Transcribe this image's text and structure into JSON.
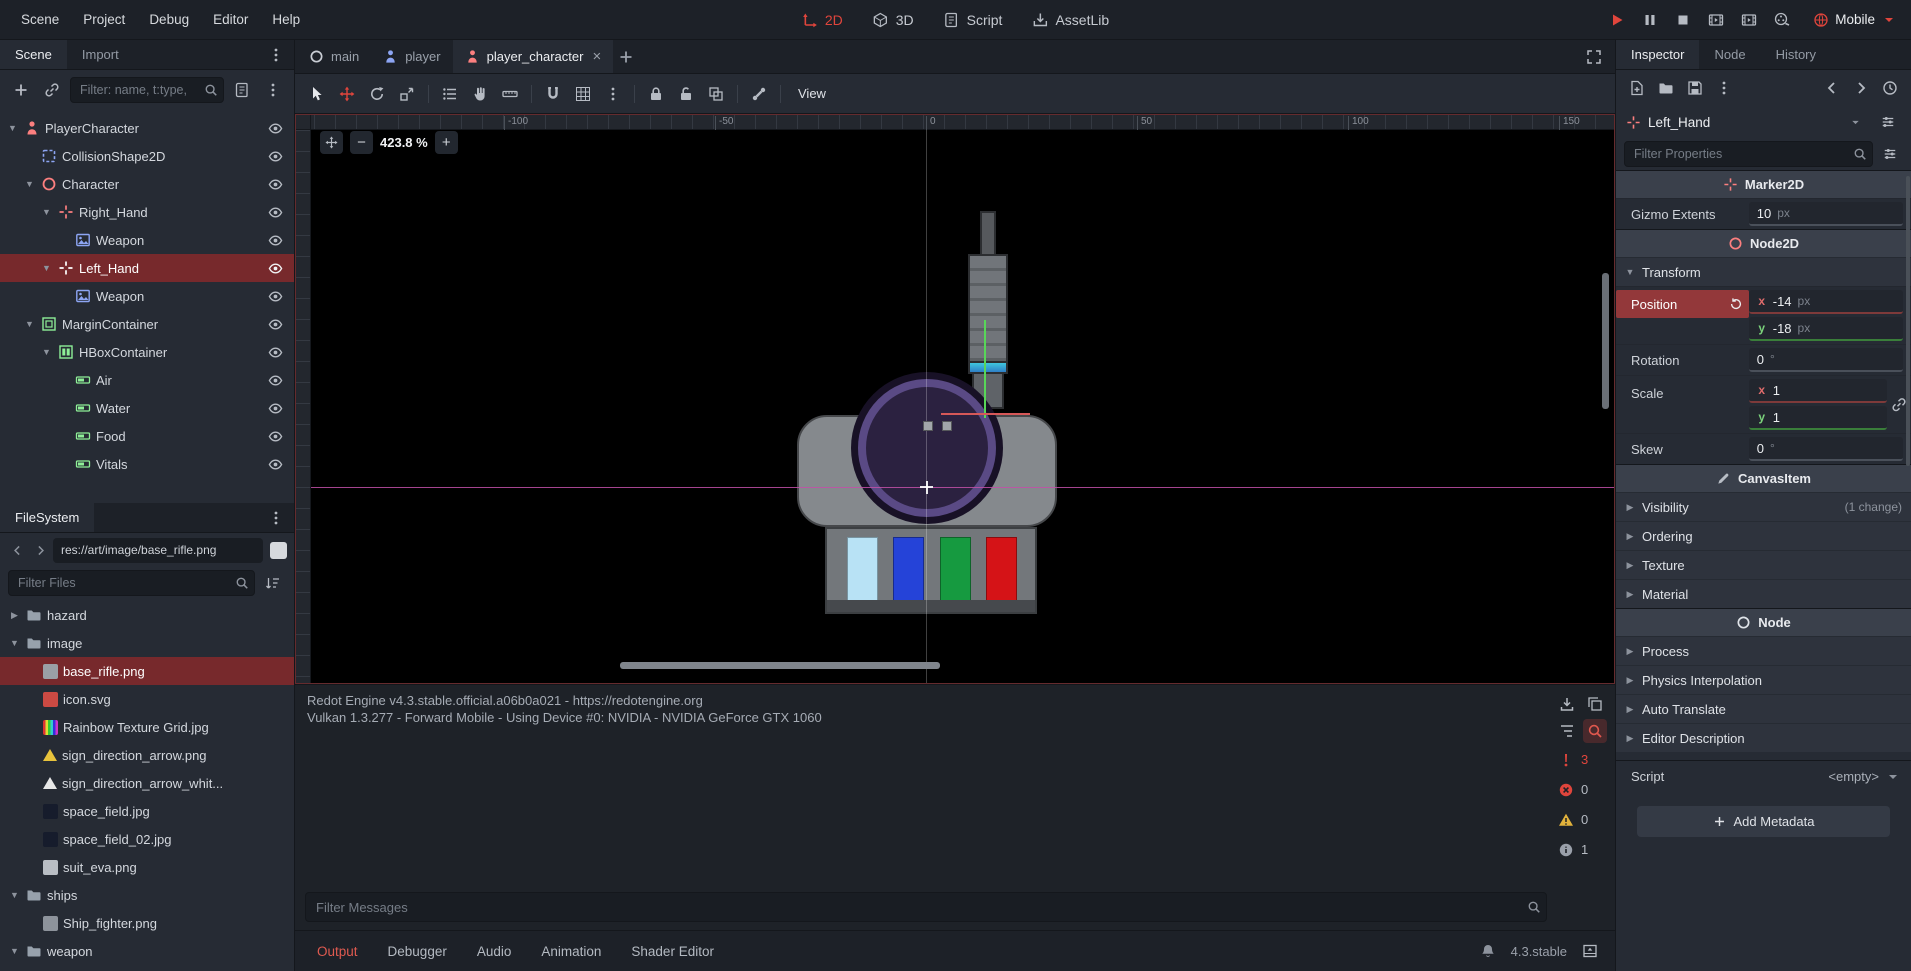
{
  "app": {
    "accent": "#e0453c"
  },
  "menubar": {
    "menus": [
      "Scene",
      "Project",
      "Debug",
      "Editor",
      "Help"
    ],
    "workspaces": [
      {
        "label": "2D",
        "icon": "axes",
        "active": true
      },
      {
        "label": "3D",
        "icon": "cube",
        "active": false
      },
      {
        "label": "Script",
        "icon": "script",
        "active": false
      },
      {
        "label": "AssetLib",
        "icon": "assetlib",
        "active": false
      }
    ],
    "playback": [
      {
        "name": "play",
        "icon": "play",
        "accent": true
      },
      {
        "name": "pause",
        "icon": "pause",
        "accent": false
      },
      {
        "name": "stop",
        "icon": "stop",
        "accent": false
      },
      {
        "name": "play-scene",
        "icon": "film",
        "accent": false
      },
      {
        "name": "play-custom-scene",
        "icon": "film",
        "accent": false
      },
      {
        "name": "movie-maker",
        "icon": "reel",
        "accent": false
      }
    ],
    "renderer_label": "Mobile"
  },
  "left_dock": {
    "tabs": [
      {
        "label": "Scene",
        "active": true
      },
      {
        "label": "Import",
        "active": false
      }
    ],
    "filter_placeholder": "Filter: name, t:type,",
    "scene_tree": [
      {
        "label": "PlayerCharacter",
        "level": 0,
        "arrow": "v",
        "icon": "body",
        "color": "#fc7f7f",
        "selected": false
      },
      {
        "label": "CollisionShape2D",
        "level": 1,
        "arrow": "",
        "icon": "collision",
        "color": "#8da5f3",
        "selected": false
      },
      {
        "label": "Character",
        "level": 1,
        "arrow": "v",
        "icon": "nodec",
        "color": "#fc7f7f",
        "selected": false
      },
      {
        "label": "Right_Hand",
        "level": 2,
        "arrow": "v",
        "icon": "marker",
        "color": "#fc7f7f",
        "selected": false
      },
      {
        "label": "Weapon",
        "level": 3,
        "arrow": "",
        "icon": "sprite",
        "color": "#8da5f3",
        "selected": false
      },
      {
        "label": "Left_Hand",
        "level": 2,
        "arrow": "v",
        "icon": "marker",
        "color": "#ffffff",
        "selected": true
      },
      {
        "label": "Weapon",
        "level": 3,
        "arrow": "",
        "icon": "sprite",
        "color": "#8da5f3",
        "selected": false
      },
      {
        "label": "MarginContainer",
        "level": 1,
        "arrow": "v",
        "icon": "container",
        "color": "#8eef97",
        "selected": false
      },
      {
        "label": "HBoxContainer",
        "level": 2,
        "arrow": "v",
        "icon": "hbox",
        "color": "#8eef97",
        "selected": false
      },
      {
        "label": "Air",
        "level": 3,
        "arrow": "",
        "icon": "progress",
        "color": "#8eef97",
        "selected": false
      },
      {
        "label": "Water",
        "level": 3,
        "arrow": "",
        "icon": "progress",
        "color": "#8eef97",
        "selected": false
      },
      {
        "label": "Food",
        "level": 3,
        "arrow": "",
        "icon": "progress",
        "color": "#8eef97",
        "selected": false
      },
      {
        "label": "Vitals",
        "level": 3,
        "arrow": "",
        "icon": "progress",
        "color": "#8eef97",
        "selected": false
      }
    ],
    "filesystem": {
      "title": "FileSystem",
      "path": "res://art/image/base_rifle.png",
      "filter_placeholder": "Filter Files",
      "tree": [
        {
          "label": "hazard",
          "level": 0,
          "type": "folder",
          "arrow": ">",
          "color": "#97a1ac",
          "selected": false
        },
        {
          "label": "image",
          "level": 0,
          "type": "folder",
          "arrow": "v",
          "color": "#97a1ac",
          "selected": false
        },
        {
          "label": "base_rifle.png",
          "level": 1,
          "type": "file",
          "arrow": "",
          "color": "#9aa0a6",
          "selected": true
        },
        {
          "label": "icon.svg",
          "level": 1,
          "type": "file",
          "arrow": "",
          "color": "#cc4a43",
          "selected": false
        },
        {
          "label": "Rainbow Texture Grid.jpg",
          "level": 1,
          "type": "rainbow",
          "arrow": "",
          "color": "",
          "selected": false
        },
        {
          "label": "sign_direction_arrow.png",
          "level": 1,
          "type": "tri",
          "arrow": "",
          "color": "#e8c33c",
          "selected": false
        },
        {
          "label": "sign_direction_arrow_whit...",
          "level": 1,
          "type": "tri",
          "arrow": "",
          "color": "#e8e8e8",
          "selected": false
        },
        {
          "label": "space_field.jpg",
          "level": 1,
          "type": "file",
          "arrow": "",
          "color": "#161c2c",
          "selected": false
        },
        {
          "label": "space_field_02.jpg",
          "level": 1,
          "type": "file",
          "arrow": "",
          "color": "#161c2c",
          "selected": false
        },
        {
          "label": "suit_eva.png",
          "level": 1,
          "type": "file",
          "arrow": "",
          "color": "#b9bec4",
          "selected": false
        },
        {
          "label": "ships",
          "level": 0,
          "type": "folder",
          "arrow": "v",
          "color": "#97a1ac",
          "selected": false
        },
        {
          "label": "Ship_fighter.png",
          "level": 1,
          "type": "file",
          "arrow": "",
          "color": "#8d939b",
          "selected": false
        },
        {
          "label": "weapon",
          "level": 0,
          "type": "folder",
          "arrow": "v",
          "color": "#97a1ac",
          "selected": false
        }
      ]
    }
  },
  "center": {
    "scene_tabs": [
      {
        "label": "main",
        "icon": "nodec",
        "icon_color": "#c9cdd4",
        "active": false,
        "closable": false
      },
      {
        "label": "player",
        "icon": "body",
        "icon_color": "#8da5f3",
        "active": false,
        "closable": false
      },
      {
        "label": "player_character",
        "icon": "body",
        "icon_color": "#fc7f7f",
        "active": true,
        "closable": true
      }
    ],
    "tools": [
      {
        "name": "select-tool",
        "icon": "cursor",
        "style": "white"
      },
      {
        "name": "move-tool",
        "icon": "move",
        "style": "accent"
      },
      {
        "name": "rotate-tool",
        "icon": "rotate",
        "style": ""
      },
      {
        "name": "scale-tool",
        "icon": "scale",
        "style": ""
      },
      {
        "sep": true
      },
      {
        "name": "list-select-tool",
        "icon": "list",
        "style": ""
      },
      {
        "name": "pan-tool",
        "icon": "hand",
        "style": ""
      },
      {
        "name": "ruler-tool",
        "icon": "ruler",
        "style": ""
      },
      {
        "sep": true
      },
      {
        "name": "smart-snap-toggle",
        "icon": "magnet",
        "style": ""
      },
      {
        "name": "grid-snap-toggle",
        "icon": "grid",
        "style": ""
      },
      {
        "name": "snap-options-menu",
        "icon": "dotsv",
        "style": ""
      },
      {
        "sep": true
      },
      {
        "name": "lock-selection-button",
        "icon": "lock",
        "style": ""
      },
      {
        "name": "unlock-selection-button",
        "icon": "unlock",
        "style": ""
      },
      {
        "name": "group-selection-button",
        "icon": "group",
        "style": ""
      },
      {
        "sep": true
      },
      {
        "name": "skeleton-options-menu",
        "icon": "bone",
        "style": ""
      },
      {
        "sep": true
      }
    ],
    "view_label": "View",
    "zoom": "423.8 %",
    "ruler_marks": [
      "-100",
      "-50",
      "0",
      "50",
      "100",
      "150"
    ],
    "canvas": {
      "bar_colors": [
        "#b8e2f5",
        "#2543d8",
        "#169a40",
        "#d51317"
      ],
      "rifle_accent": "#3fc6dd"
    },
    "log_lines": [
      "Redot Engine v4.3.stable.official.a06b0a021 - https://redotengine.org",
      "Vulkan 1.3.277 - Forward Mobile - Using Device #0: NVIDIA - NVIDIA GeForce GTX 1060"
    ],
    "filter_messages_placeholder": "Filter Messages",
    "message_filters": [
      {
        "name": "errors-and-warnings",
        "icon": "alert",
        "color": "#e0453c",
        "count": "3",
        "count_color": "#e0453c"
      },
      {
        "name": "errors",
        "icon": "errx",
        "color": "#e0453c",
        "count": "0",
        "count_color": "#b6bbc3"
      },
      {
        "name": "warnings",
        "icon": "warn",
        "color": "#e2b33c",
        "count": "0",
        "count_color": "#b6bbc3"
      },
      {
        "name": "messages",
        "icon": "info",
        "color": "#9aa0aa",
        "count": "1",
        "count_color": "#b6bbc3"
      }
    ],
    "bottom_tabs": [
      {
        "label": "Output",
        "active": true
      },
      {
        "label": "Debugger",
        "active": false
      },
      {
        "label": "Audio",
        "active": false
      },
      {
        "label": "Animation",
        "active": false
      },
      {
        "label": "Shader Editor",
        "active": false
      }
    ],
    "version": "4.3.stable"
  },
  "inspector": {
    "tabs": [
      {
        "label": "Inspector",
        "active": true
      },
      {
        "label": "Node",
        "active": false
      },
      {
        "label": "History",
        "active": false
      }
    ],
    "node_name": "Left_Hand",
    "filter_placeholder": "Filter Properties",
    "content": [
      {
        "kind": "category",
        "label": "Marker2D",
        "icon": "marker",
        "color": "#fc7f7f"
      },
      {
        "kind": "prop",
        "label": "Gizmo Extents",
        "value": "10",
        "suffix": "px"
      },
      {
        "kind": "category",
        "label": "Node2D",
        "icon": "nodec",
        "color": "#fc7f7f"
      },
      {
        "kind": "group",
        "label": "Transform",
        "expanded": true,
        "note": ""
      },
      {
        "kind": "vec2",
        "label": "Position",
        "highlight": true,
        "revert": true,
        "link": false,
        "rows": [
          {
            "axis": "x",
            "value": "-14",
            "suffix": "px"
          },
          {
            "axis": "y",
            "value": "-18",
            "suffix": "px"
          }
        ]
      },
      {
        "kind": "prop",
        "label": "Rotation",
        "value": "0",
        "suffix": "°"
      },
      {
        "kind": "vec2",
        "label": "Scale",
        "highlight": false,
        "revert": false,
        "link": true,
        "rows": [
          {
            "axis": "x",
            "value": "1",
            "suffix": ""
          },
          {
            "axis": "y",
            "value": "1",
            "suffix": ""
          }
        ]
      },
      {
        "kind": "prop",
        "label": "Skew",
        "value": "0",
        "suffix": "°"
      },
      {
        "kind": "category",
        "label": "CanvasItem",
        "icon": "pencil",
        "color": "#b8bdc5"
      },
      {
        "kind": "group",
        "label": "Visibility",
        "expanded": false,
        "note": "(1 change)"
      },
      {
        "kind": "group",
        "label": "Ordering",
        "expanded": false,
        "note": ""
      },
      {
        "kind": "group",
        "label": "Texture",
        "expanded": false,
        "note": ""
      },
      {
        "kind": "group",
        "label": "Material",
        "expanded": false,
        "note": ""
      },
      {
        "kind": "category",
        "label": "Node",
        "icon": "nodec",
        "color": "#dfe3e8"
      },
      {
        "kind": "group",
        "label": "Process",
        "expanded": false,
        "note": ""
      },
      {
        "kind": "group",
        "label": "Physics Interpolation",
        "expanded": false,
        "note": ""
      },
      {
        "kind": "group",
        "label": "Auto Translate",
        "expanded": false,
        "note": ""
      },
      {
        "kind": "group",
        "label": "Editor Description",
        "expanded": false,
        "note": ""
      },
      {
        "kind": "script",
        "label": "Script",
        "value": "<empty>"
      },
      {
        "kind": "button",
        "label": "Add Metadata"
      }
    ]
  }
}
